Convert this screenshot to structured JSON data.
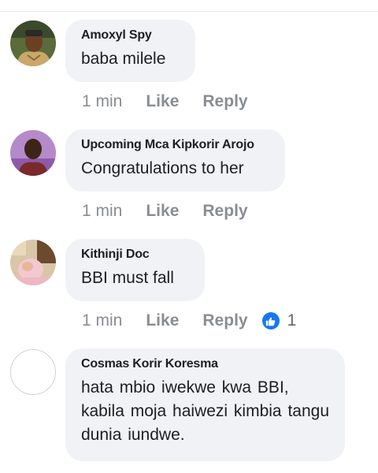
{
  "comments": [
    {
      "author": "Amoxyl Spy",
      "text": "baba milele",
      "time": "1 min",
      "like_label": "Like",
      "reply_label": "Reply"
    },
    {
      "author": "Upcoming Mca Kipkorir Arojo",
      "text": "Congratulations to her",
      "time": "1 min",
      "like_label": "Like",
      "reply_label": "Reply"
    },
    {
      "author": "Kithinji Doc",
      "text": "BBI must fall",
      "time": "1 min",
      "like_label": "Like",
      "reply_label": "Reply",
      "reaction_count": "1",
      "reaction_icon": "thumbs-up-icon"
    },
    {
      "author": "Cosmas Korir Koresma",
      "text": "hata mbio iwekwe kwa BBI, kabila moja haiwezi kimbia tangu dunia  iundwe."
    }
  ],
  "colors": {
    "bubble": "#f0f2f5",
    "action_text": "#8a8d91",
    "like_blue": "#1877f2"
  }
}
